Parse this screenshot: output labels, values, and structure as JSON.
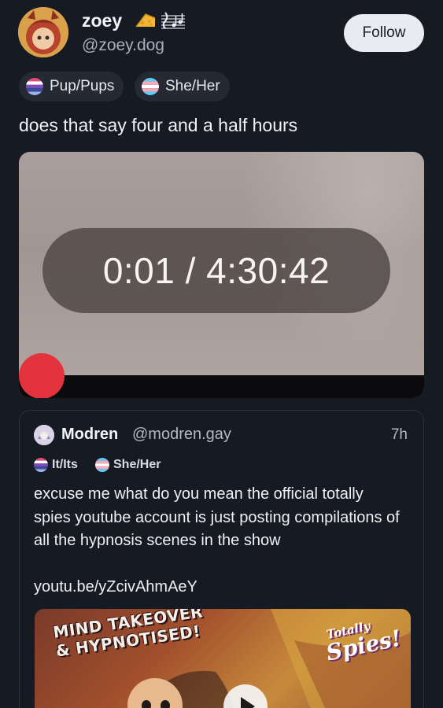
{
  "author": {
    "display_name": "zoey",
    "handle": "@zoey.dog",
    "name_emojis": [
      "cheese-icon",
      "music-notes-icon"
    ],
    "follow_label": "Follow",
    "pronouns": [
      "Pup/Pups",
      "She/Her"
    ]
  },
  "post": {
    "text": "does that say four and a half hours",
    "video": {
      "timecode": "0:01 / 4:30:42",
      "progress": 0.0
    }
  },
  "quoted": {
    "display_name": "Modren",
    "handle": "@modren.gay",
    "time": "7h",
    "pronouns": [
      "It/Its",
      "She/Her"
    ],
    "text": "excuse me what do you mean the official totally spies youtube account is just posting compilations of all the hypnosis scenes in the show",
    "link": "youtu.be/yZcivAhmAeY",
    "thumbnail": {
      "title_line1": "MIND TAKEOVER",
      "title_line2": "& HYPNOTISED!",
      "logo_line1": "Totally",
      "logo_line2": "Spies!"
    }
  },
  "colors": {
    "background": "#161a22",
    "chip": "#242933",
    "follow_button": "#e9ebf0",
    "progress_knob": "#e3333d"
  }
}
